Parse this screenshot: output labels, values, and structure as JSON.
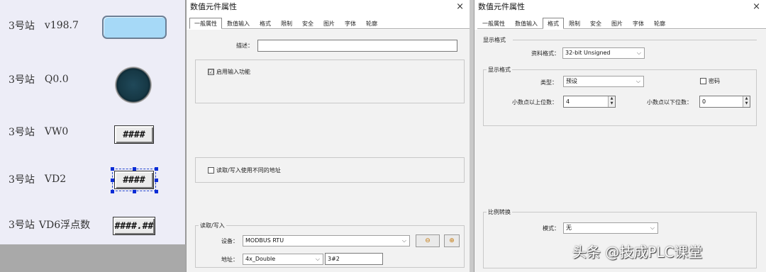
{
  "canvas": {
    "rows": [
      {
        "station": "3号站",
        "address": "v198.7"
      },
      {
        "station": "3号站",
        "address": "Q0.0"
      },
      {
        "station": "3号站",
        "address": "VW0"
      },
      {
        "station": "3号站",
        "address": "VD2"
      },
      {
        "station": "3号站",
        "address": "VD6浮点数"
      }
    ],
    "numeric_displays": [
      "####",
      "####",
      "####.##"
    ]
  },
  "dialog1": {
    "title": "数值元件属性",
    "close": "×",
    "tabs": [
      "一般属性",
      "数值输入",
      "格式",
      "限制",
      "安全",
      "图片",
      "字体",
      "轮廓"
    ],
    "desc_label": "描述：",
    "desc_value": "",
    "enable_input_label": "启用输入功能",
    "enable_input_checked": "☑",
    "diff_addr_label": "读取/写入使用不同的地址",
    "rw_group_label": "读取/写入",
    "device_label": "设备：",
    "device_value": "MODBUS RTU",
    "addr_label": "地址：",
    "addr_type": "4x_Double",
    "addr_value": "3#2"
  },
  "dialog2": {
    "title": "数值元件属性",
    "close": "×",
    "tabs": [
      "一般属性",
      "数值输入",
      "格式",
      "限制",
      "安全",
      "图片",
      "字体",
      "轮廓"
    ],
    "display_format_header": "显示格式",
    "data_format_label": "资料格式：",
    "data_format_value": "32-bit Unsigned",
    "format_group_label": "显示格式",
    "type_label": "类型：",
    "type_value": "预设",
    "password_label": "密码",
    "int_digits_label": "小数点以上位数：",
    "int_digits_value": "4",
    "dec_digits_label": "小数点以下位数：",
    "dec_digits_value": "0",
    "scale_group_label": "比例转换",
    "mode_label": "模式：",
    "mode_value": "无"
  },
  "watermark": "头条 @技成PLC课堂",
  "colors": {
    "lcd": "#a6d9f7",
    "selection": "#0a2cd6",
    "dialog_bg": "#f2f2f2"
  }
}
